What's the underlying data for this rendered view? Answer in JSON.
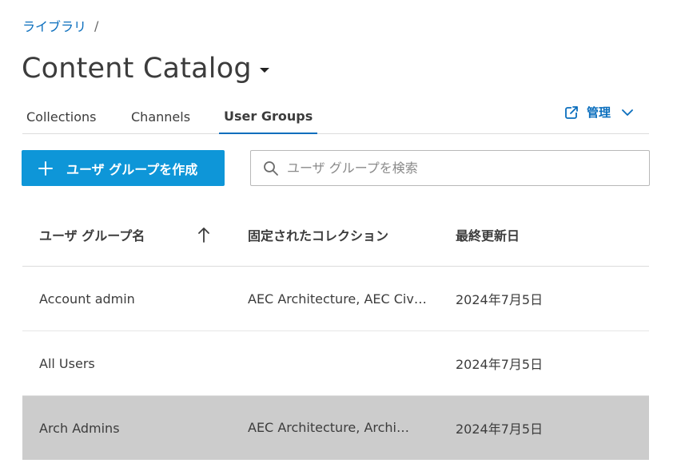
{
  "breadcrumb": {
    "library": "ライブラリ",
    "separator": "/"
  },
  "page": {
    "title": "Content Catalog"
  },
  "tabs": [
    {
      "label": "Collections"
    },
    {
      "label": "Channels"
    },
    {
      "label": "User Groups",
      "active": true
    }
  ],
  "manage": {
    "label": "管理",
    "icon": "external-link-icon"
  },
  "create_button": {
    "label": "ユーザ グループを作成",
    "icon": "plus-icon"
  },
  "search": {
    "placeholder": "ユーザ グループを検索",
    "value": ""
  },
  "table": {
    "headers": {
      "name": "ユーザ グループ名",
      "pinned": "固定されたコレクション",
      "updated": "最終更新日"
    },
    "sort": {
      "column": "name",
      "direction": "ascending"
    },
    "rows": [
      {
        "name": "Account admin",
        "pinned": "AEC Architecture, AEC Civ…",
        "updated": "2024年7月5日"
      },
      {
        "name": "All Users",
        "pinned": "",
        "updated": "2024年7月5日"
      },
      {
        "name": "Arch Admins",
        "pinned": "AEC Architecture, Archi…",
        "updated": "2024年7月5日",
        "selected": true
      }
    ]
  },
  "colors": {
    "accent": "#0a6ebd",
    "button": "#0e96d8",
    "selected_row": "#cccccc"
  }
}
